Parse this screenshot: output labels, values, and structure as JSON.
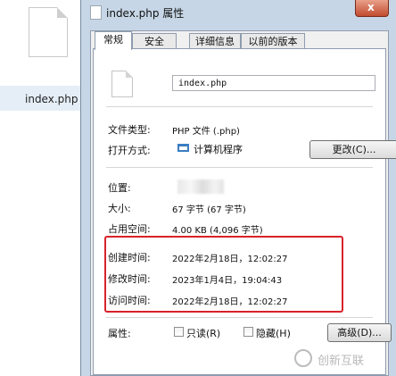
{
  "explorer": {
    "file_label": "index.php"
  },
  "window": {
    "title": "index.php 属性",
    "close_glyph": "x"
  },
  "tabs": [
    "常规",
    "安全",
    "详细信息",
    "以前的版本"
  ],
  "general": {
    "file_name": "index.php",
    "type_label": "文件类型:",
    "type_value": "PHP 文件 (.php)",
    "open_with_label": "打开方式:",
    "open_with_value": "计算机程序",
    "change_button": "更改(C)...",
    "location_label": "位置:",
    "size_label": "大小:",
    "size_value": "67 字节 (67 字节)",
    "disk_size_label": "占用空间:",
    "disk_size_value": "4.00 KB (4,096 字节)",
    "created_label": "创建时间:",
    "created_value": "2022年2月18日，12:02:27",
    "modified_label": "修改时间:",
    "modified_value": "2023年1月4日，19:04:43",
    "accessed_label": "访问时间:",
    "accessed_value": "2022年2月18日，12:02:27",
    "attributes_label": "属性:",
    "readonly_label": "只读(R)",
    "hidden_label": "隐藏(H)",
    "advanced_button": "高级(D)..."
  },
  "watermark": {
    "text": "创新互联"
  },
  "colors": {
    "highlight_border": "#d9222a",
    "window_frame": "#c6d6e6"
  }
}
